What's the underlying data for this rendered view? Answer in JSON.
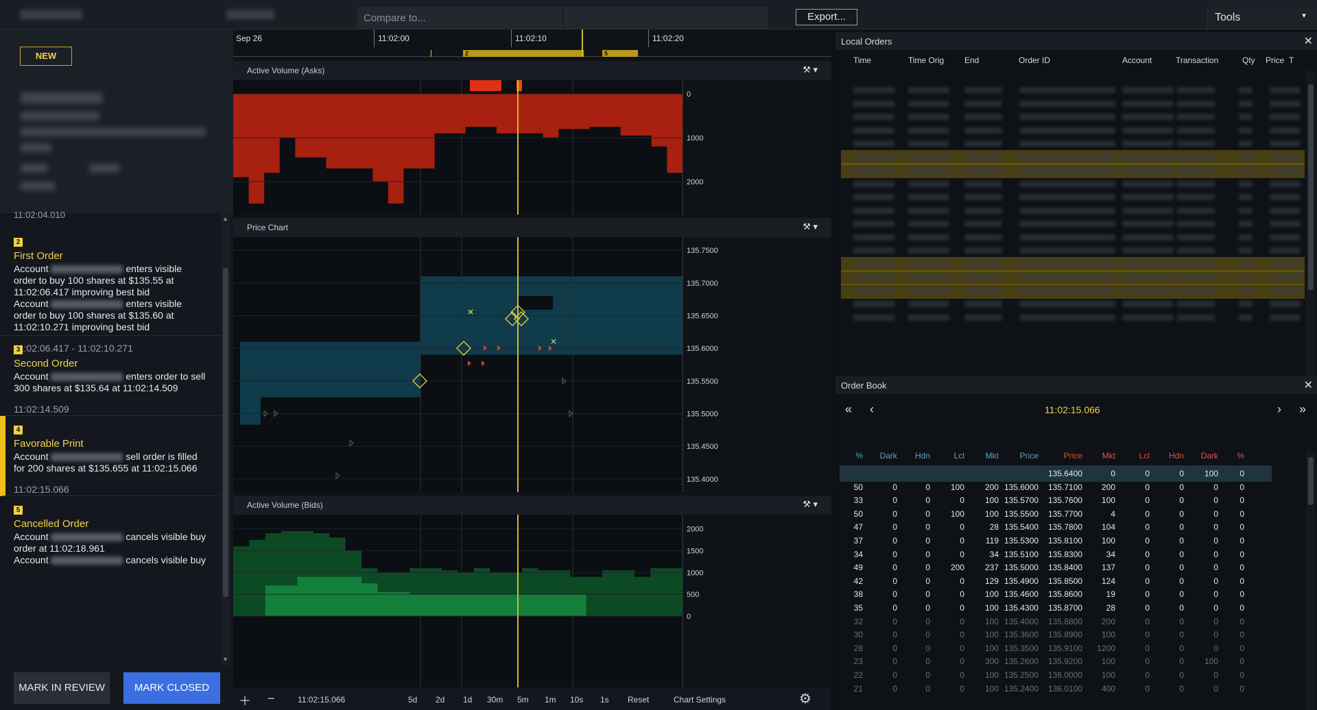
{
  "toolbar": {
    "compare_placeholder": "Compare to...",
    "export_label": "Export...",
    "tools_label": "Tools"
  },
  "case": {
    "badge": "NEW",
    "partial_time": "11:02:04.010"
  },
  "events": [
    {
      "num": "2",
      "title": "First Order",
      "lines": [
        {
          "pre": "Account",
          "post": "enters visible"
        },
        {
          "text": "order to buy 100 shares at $135.55 at"
        },
        {
          "text": "11:02:06.417 improving best bid"
        },
        {
          "pre": "Account",
          "post": "enters visible"
        },
        {
          "text": "order to buy 100 shares at $135.60 at"
        },
        {
          "text": "11:02:10.271 improving best bid"
        }
      ],
      "time": "11:02:06.417 - 11:02:10.271"
    },
    {
      "num": "3",
      "title": "Second Order",
      "lines": [
        {
          "pre": "Account",
          "post": "enters order to sell"
        },
        {
          "text": "300 shares at $135.64 at 11:02:14.509"
        }
      ],
      "time": "11:02:14.509"
    },
    {
      "num": "4",
      "title": "Favorable Print",
      "lines": [
        {
          "pre": "Account",
          "post": "sell order is filled"
        },
        {
          "text": "for 200 shares at $135.655 at 11:02:15.066"
        }
      ],
      "time": "11:02:15.066"
    },
    {
      "num": "5",
      "title": "Cancelled Order",
      "lines": [
        {
          "pre": "Account",
          "post": "cancels visible buy"
        },
        {
          "text": "order at 11:02:18.961"
        },
        {
          "pre": "Account",
          "post": "cancels visible buy"
        }
      ],
      "time": ""
    }
  ],
  "actions": {
    "review_label": "MARK IN REVIEW",
    "closed_label": "MARK CLOSED"
  },
  "timeline": {
    "labels": [
      "Sep 26",
      "11:02:00",
      "11:02:10",
      "11:02:20"
    ],
    "markers": [
      "2",
      "5"
    ]
  },
  "panels": {
    "asks_title": "Active Volume (Asks)",
    "price_title": "Price Chart",
    "bids_title": "Active Volume (Bids)"
  },
  "chart_data": [
    {
      "type": "area",
      "title": "Active Volume (Asks)",
      "ylabel": "",
      "y_ticks": [
        "0",
        "1000",
        "2000"
      ],
      "ylim": [
        0,
        2500
      ],
      "inverted": true,
      "values": [
        1900,
        2500,
        1800,
        1000,
        1450,
        1450,
        1700,
        1700,
        1700,
        2000,
        2500,
        1700,
        1700,
        900,
        900,
        750,
        750,
        900,
        900,
        900,
        1000,
        800,
        800,
        750,
        750,
        950,
        950,
        1200,
        1800
      ]
    },
    {
      "type": "area",
      "title": "Price Chart",
      "ylabel": "",
      "y_ticks": [
        "135.7500",
        "135.7000",
        "135.6500",
        "135.6000",
        "135.5500",
        "135.5000",
        "135.4500",
        "135.4000"
      ],
      "ylim": [
        135.38,
        135.77
      ],
      "bid": [
        135.61,
        135.61,
        135.61,
        135.61,
        135.61,
        135.61,
        135.61,
        135.61,
        135.61,
        135.61,
        135.61,
        135.61,
        135.61,
        135.61,
        135.61,
        135.61,
        135.61,
        135.61,
        135.61
      ],
      "ask": [
        135.55,
        135.55,
        135.55,
        135.55,
        135.55,
        135.55,
        135.55,
        135.55,
        135.55,
        135.55,
        135.55,
        135.7,
        135.7,
        135.7,
        135.7,
        135.7,
        135.7,
        135.7,
        135.7
      ]
    },
    {
      "type": "area",
      "title": "Active Volume (Bids)",
      "ylabel": "",
      "y_ticks": [
        "2000",
        "1500",
        "1000",
        "500",
        "0"
      ],
      "ylim": [
        0,
        2200
      ],
      "values": [
        1600,
        1750,
        1900,
        1950,
        1950,
        1900,
        1800,
        1500,
        1100,
        1000,
        1000,
        1100,
        1100,
        1050,
        1000,
        1100,
        1000,
        1000,
        1100,
        1050,
        1050,
        900,
        900,
        1050,
        1050,
        900,
        1100,
        1100
      ],
      "base": [
        0,
        0,
        700,
        700,
        900,
        900,
        900,
        900,
        750,
        550,
        550,
        500,
        500,
        500,
        500,
        500,
        500,
        500,
        500,
        500,
        500,
        500,
        0,
        0,
        0,
        0,
        0,
        0
      ]
    }
  ],
  "chart_footer": {
    "time": "11:02:15.066",
    "ranges": [
      "5d",
      "2d",
      "1d",
      "30m",
      "5m",
      "1m",
      "10s",
      "1s",
      "Reset",
      "Chart Settings"
    ]
  },
  "local_orders": {
    "title": "Local Orders",
    "columns": [
      "Time",
      "Time Orig",
      "End",
      "Order ID",
      "Account",
      "Transaction",
      "Qty",
      "Price",
      "T"
    ]
  },
  "order_book": {
    "title": "Order Book",
    "time": "11:02:15.066",
    "columns": [
      "%",
      "Dark",
      "Hdn",
      "Lcl",
      "Mkt",
      "Price",
      "Price",
      "Mkt",
      "Lcl",
      "Hdn",
      "Dark",
      "%"
    ],
    "rows": [
      [
        "",
        "",
        "",
        "",
        "",
        "",
        "135.6400",
        "0",
        "0",
        "0",
        "100",
        "0"
      ],
      [
        "50",
        "0",
        "0",
        "100",
        "200",
        "135.6000",
        "135.7100",
        "200",
        "0",
        "0",
        "0",
        "0"
      ],
      [
        "33",
        "0",
        "0",
        "0",
        "100",
        "135.5700",
        "135.7600",
        "100",
        "0",
        "0",
        "0",
        "0"
      ],
      [
        "50",
        "0",
        "0",
        "100",
        "100",
        "135.5500",
        "135.7700",
        "4",
        "0",
        "0",
        "0",
        "0"
      ],
      [
        "47",
        "0",
        "0",
        "0",
        "28",
        "135.5400",
        "135.7800",
        "104",
        "0",
        "0",
        "0",
        "0"
      ],
      [
        "37",
        "0",
        "0",
        "0",
        "119",
        "135.5300",
        "135.8100",
        "100",
        "0",
        "0",
        "0",
        "0"
      ],
      [
        "34",
        "0",
        "0",
        "0",
        "34",
        "135.5100",
        "135.8300",
        "34",
        "0",
        "0",
        "0",
        "0"
      ],
      [
        "49",
        "0",
        "0",
        "200",
        "237",
        "135.5000",
        "135.8400",
        "137",
        "0",
        "0",
        "0",
        "0"
      ],
      [
        "42",
        "0",
        "0",
        "0",
        "129",
        "135.4900",
        "135.8500",
        "124",
        "0",
        "0",
        "0",
        "0"
      ],
      [
        "38",
        "0",
        "0",
        "0",
        "100",
        "135.4600",
        "135.8600",
        "19",
        "0",
        "0",
        "0",
        "0"
      ],
      [
        "35",
        "0",
        "0",
        "0",
        "100",
        "135.4300",
        "135.8700",
        "28",
        "0",
        "0",
        "0",
        "0"
      ],
      [
        "32",
        "0",
        "0",
        "0",
        "100",
        "135.4000",
        "135.8800",
        "200",
        "0",
        "0",
        "0",
        "0"
      ],
      [
        "30",
        "0",
        "0",
        "0",
        "100",
        "135.3600",
        "135.8900",
        "100",
        "0",
        "0",
        "0",
        "0"
      ],
      [
        "28",
        "0",
        "0",
        "0",
        "100",
        "135.3500",
        "135.9100",
        "1200",
        "0",
        "0",
        "0",
        "0"
      ],
      [
        "23",
        "0",
        "0",
        "0",
        "300",
        "135.2600",
        "135.9200",
        "100",
        "0",
        "0",
        "100",
        "0"
      ],
      [
        "22",
        "0",
        "0",
        "0",
        "100",
        "135.2500",
        "136.0000",
        "100",
        "0",
        "0",
        "0",
        "0"
      ],
      [
        "21",
        "0",
        "0",
        "0",
        "100",
        "135.2400",
        "136.0100",
        "400",
        "0",
        "0",
        "0",
        "0"
      ]
    ]
  },
  "colors": {
    "accent": "#f0d24a",
    "asks": "#a8200f",
    "bids": "#0e6b2c",
    "price_fill": "#0f3b4a",
    "closed_button": "#3b6fe0"
  }
}
